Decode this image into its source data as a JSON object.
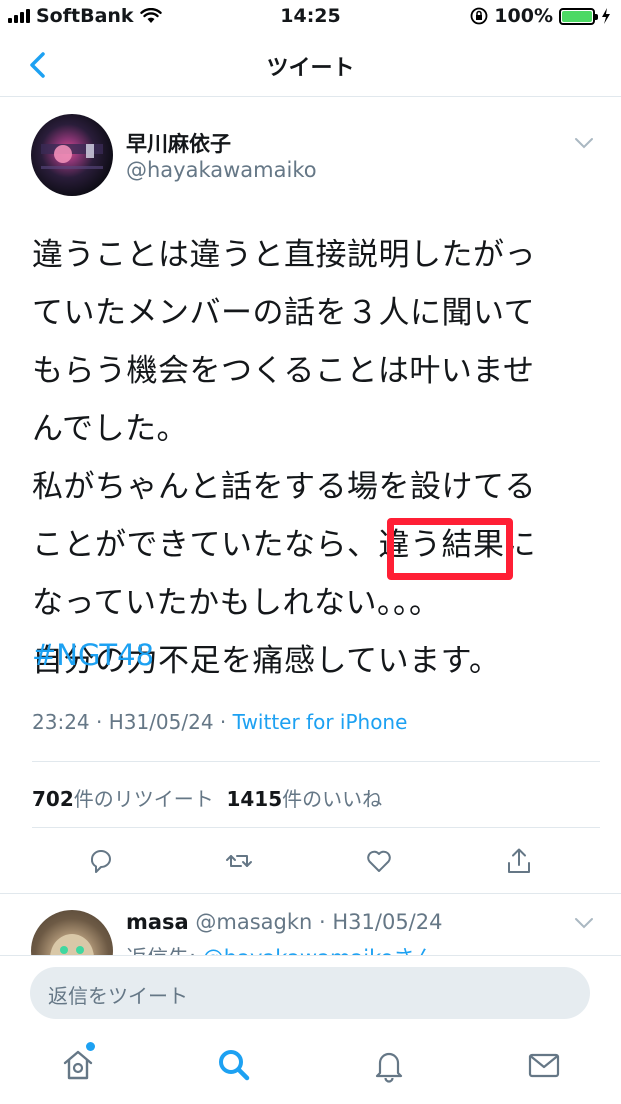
{
  "status_bar": {
    "carrier": "SoftBank",
    "time": "14:25",
    "battery": "100%"
  },
  "nav": {
    "title": "ツイート"
  },
  "tweet": {
    "author_name": "早川麻依子",
    "author_handle": "@hayakawamaiko",
    "lines": [
      "違うことは違うと直接説明したがっ",
      "ていたメンバーの話を３人に聞いて",
      "もらう機会をつくることは叶いませ",
      "んでした。",
      "私がちゃんと話をする場を設けてる",
      "ことができていたなら、違う結果に",
      "なっていたかもしれない。。。",
      "自分の力不足を痛感しています。"
    ],
    "hashtag": "#NGT48",
    "timestamp": "23:24 · H31/05/24 · ",
    "source": "Twitter for iPhone",
    "retweet_count": "702",
    "retweet_label": "件のリツイート",
    "like_count": "1415",
    "like_label": "件のいいね"
  },
  "reply": {
    "name": "masa",
    "handle_date": " @masagkn · H31/05/24",
    "prefix": "返信先: ",
    "mention": "@hayakawamaikoさん"
  },
  "compose": {
    "placeholder": "返信をツイート"
  },
  "icons": {
    "back": "chevron-left-icon",
    "caret": "chevron-down-icon",
    "reply": "reply-icon",
    "retweet": "retweet-icon",
    "like": "heart-icon",
    "share": "share-icon",
    "home": "home-icon",
    "search": "search-icon",
    "notifications": "bell-icon",
    "messages": "mail-icon"
  },
  "colors": {
    "accent": "#1da1f2",
    "highlight": "#ff1f35",
    "muted": "#657786"
  }
}
